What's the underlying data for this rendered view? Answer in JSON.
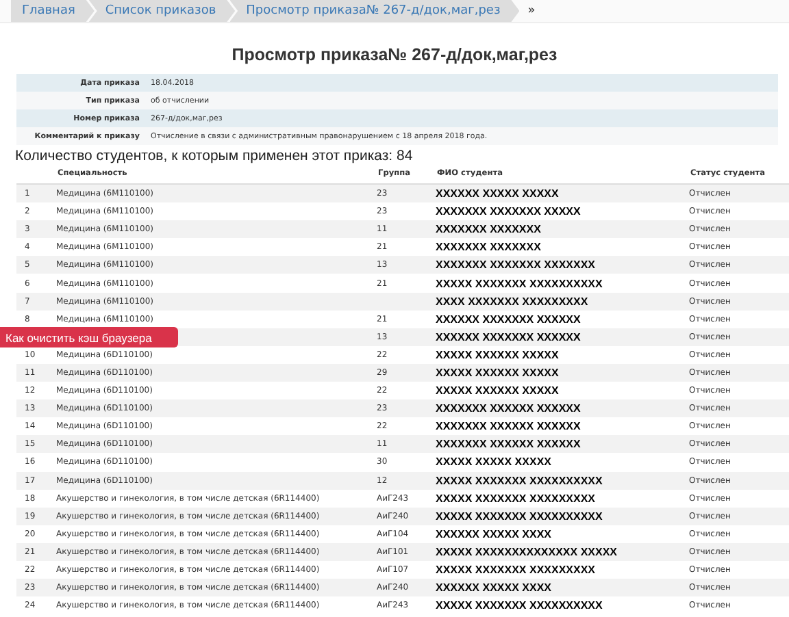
{
  "breadcrumbs": [
    {
      "label": "Главная"
    },
    {
      "label": "Список приказов"
    },
    {
      "label": "Просмотр приказа№ 267-д/док,маг,рез"
    }
  ],
  "breadcrumb_more": "»",
  "title": "Просмотр приказа№ 267-д/док,маг,рез",
  "details": [
    {
      "label": "Дата приказа",
      "value": "18.04.2018"
    },
    {
      "label": "Тип приказа",
      "value": "об отчислении"
    },
    {
      "label": "Номер приказа",
      "value": "267-д/док,маг,рез"
    },
    {
      "label": "Комментарий к приказу",
      "value": "Отчисление в связи с административным правонарушением с 18 апреля 2018 года."
    }
  ],
  "students_heading": "Количество студентов, к которым применен этот приказ: 84",
  "table": {
    "columns": [
      "",
      "Специальность",
      "Группа",
      "ФИО студента",
      "Статус студента"
    ],
    "rows": [
      [
        "1",
        "Медицина (6M110100)",
        "23",
        "XXXXXX XXXXX XXXXX",
        "Отчислен"
      ],
      [
        "2",
        "Медицина (6M110100)",
        "23",
        "XXXXXXX XXXXXXX XXXXX",
        "Отчислен"
      ],
      [
        "3",
        "Медицина (6M110100)",
        "11",
        "XXXXXXX XXXXXXX",
        "Отчислен"
      ],
      [
        "4",
        "Медицина (6M110100)",
        "21",
        "XXXXXXX XXXXXXX",
        "Отчислен"
      ],
      [
        "5",
        "Медицина (6M110100)",
        "13",
        "XXXXXXX XXXXXXX XXXXXXX",
        "Отчислен"
      ],
      [
        "6",
        "Медицина (6M110100)",
        "21",
        "XXXXX XXXXXXX XXXXXXXXXX",
        "Отчислен"
      ],
      [
        "7",
        "Медицина (6M110100)",
        "",
        "XXXX XXXXXXX XXXXXXXXX",
        "Отчислен"
      ],
      [
        "8",
        "Медицина (6M110100)",
        "21",
        "XXXXXX XXXXXXX XXXXXX",
        "Отчислен"
      ],
      [
        "",
        "",
        "13",
        "XXXXXX XXXXXXX XXXXXX",
        "Отчислен"
      ],
      [
        "10",
        "Медицина (6D110100)",
        "22",
        "XXXXX XXXXXX XXXXX",
        "Отчислен"
      ],
      [
        "11",
        "Медицина (6D110100)",
        "29",
        "XXXXX XXXXXX XXXXX",
        "Отчислен"
      ],
      [
        "12",
        "Медицина (6D110100)",
        "22",
        "XXXXX XXXXXX XXXXX",
        "Отчислен"
      ],
      [
        "13",
        "Медицина (6D110100)",
        "23",
        "XXXXXXX XXXXXX XXXXXX",
        "Отчислен"
      ],
      [
        "14",
        "Медицина (6D110100)",
        "22",
        "XXXXXXX XXXXXX XXXXXX",
        "Отчислен"
      ],
      [
        "15",
        "Медицина (6D110100)",
        "11",
        "XXXXXXX XXXXXX XXXXXX",
        "Отчислен"
      ],
      [
        "16",
        "Медицина (6D110100)",
        "30",
        "XXXXX XXXXX XXXXX",
        "Отчислен"
      ],
      [
        "17",
        "Медицина (6D110100)",
        "12",
        "XXXXX XXXXXXX XXXXXXXXXX",
        "Отчислен"
      ],
      [
        "18",
        "Акушерство и гинекология, в том числе детская (6R114400)",
        "АиГ243",
        "XXXXX XXXXXXX XXXXXXXXX",
        "Отчислен"
      ],
      [
        "19",
        "Акушерство и гинекология, в том числе детская (6R114400)",
        "АиГ240",
        "XXXXX XXXXXXX XXXXXXXXXX",
        "Отчислен"
      ],
      [
        "20",
        "Акушерство и гинекология, в том числе детская (6R114400)",
        "АиГ104",
        "XXXXXX XXXXX XXXX",
        "Отчислен"
      ],
      [
        "21",
        "Акушерство и гинекология, в том числе детская (6R114400)",
        "АиГ101",
        "XXXXX XXXXXXXXXXXXXX XXXXX",
        "Отчислен"
      ],
      [
        "22",
        "Акушерство и гинекология, в том числе детская (6R114400)",
        "АиГ107",
        "XXXXX XXXXXXX XXXXXXXXX",
        "Отчислен"
      ],
      [
        "23",
        "Акушерство и гинекология, в том числе детская (6R114400)",
        "АиГ240",
        "XXXXXX XXXXX XXXX",
        "Отчислен"
      ],
      [
        "24",
        "Акушерство и гинекология, в том числе детская (6R114400)",
        "АиГ243",
        "XXXXX XXXXXXX XXXXXXXXXX",
        "Отчислен"
      ]
    ]
  },
  "floating_button": "Как очистить кэш браузера"
}
